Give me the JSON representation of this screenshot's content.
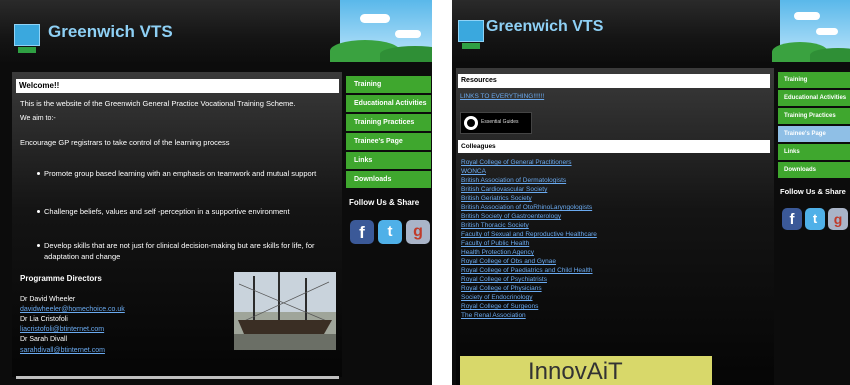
{
  "left": {
    "site_title": "Greenwich VTS",
    "welcome_heading": "Welcome!!",
    "intro": "This is the website of the Greenwich General Practice Vocational Training Scheme.",
    "aim": "We aim to:-",
    "encourage": "Encourage GP registrars to take control of the learning process",
    "bullets": [
      "Promote group based learning with an emphasis on teamwork and mutual support",
      "Challenge beliefs, values and self -perception in a supportive environment",
      "Develop skills that are not just for clinical decision-making but are skills for life, for",
      "adaptation and change"
    ],
    "directors_heading": "Programme Directors",
    "directors": [
      {
        "name": "Dr David Wheeler",
        "email": "davidwheeler@homechoice.co.uk"
      },
      {
        "name": "Dr Lia Cristofoli",
        "email": "liacristofoli@btinternet.com"
      },
      {
        "name": "Dr Sarah Divall",
        "email": "sarahdivall@btinternet.com"
      }
    ],
    "nav": [
      "Training",
      "Educational Activities",
      "Training Practices",
      "Trainee's Page",
      "Links",
      "Downloads"
    ],
    "follow": "Follow Us & Share"
  },
  "right": {
    "site_title": "Greenwich VTS",
    "resources_heading": "Resources",
    "links_everything": "LINKS TO EVERYTHING!!!!!!",
    "essential_guides": "Essential Guides",
    "colleagues_heading": "Colleagues",
    "colleagues": [
      "Royal College of General Practitioners",
      "WONCA",
      "British Association of Dermatologists",
      "British Cardiovascular Society",
      "British Geriatrics Society",
      "British Association of OtoRhinoLaryngologists",
      "British Society of Gastroenterology",
      "British Thoracic Society",
      "Faculty of Sexual and Reproductive Healthcare",
      "Faculty of Public Health",
      "Health Protection Agency",
      "Royal College of Obs and Gynae",
      "Royal College of Paediatrics and Child Health",
      "Royal College of Psychiatrists",
      "Royal College of Physicians",
      "Society of Endocrinology",
      "Royal College of Surgeons",
      "The Renal Association"
    ],
    "innovait": "InnovAiT",
    "nav": [
      "Training",
      "Educational Activities",
      "Training Practices",
      "Trainee's Page",
      "Links",
      "Downloads"
    ],
    "follow": "Follow Us & Share"
  },
  "colors": {
    "accent_green": "#3fa72e",
    "active_nav": "#8fbfe6",
    "title_blue": "#8ed0f5",
    "link_blue": "#6aaaf0"
  },
  "icons": [
    "facebook-icon",
    "twitter-icon",
    "google-plus-icon",
    "logo-icon"
  ]
}
